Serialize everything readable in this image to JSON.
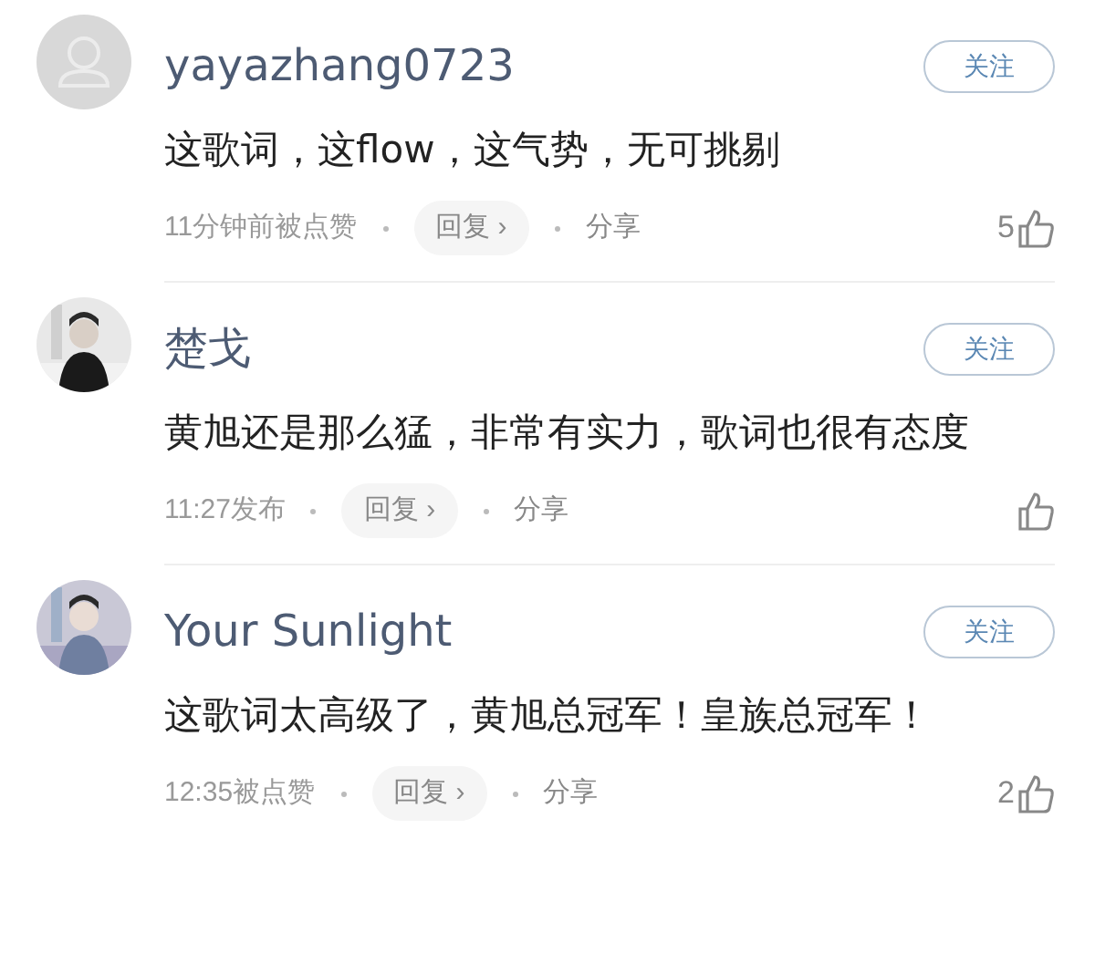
{
  "comments": [
    {
      "avatar": {
        "kind": "default"
      },
      "username": "yayazhang0723",
      "follow": "关注",
      "text": "这歌词，这flow，这气势，无可挑剔",
      "time": "11分钟前被点赞",
      "reply": "回复",
      "reply_arrow": "›",
      "share": "分享",
      "likes": "5"
    },
    {
      "username": "楚戈",
      "follow": "关注",
      "text": "黄旭还是那么猛，非常有实力，歌词也很有态度",
      "time": "11:27发布",
      "reply": "回复",
      "reply_arrow": "›",
      "share": "分享"
    },
    {
      "username": "Your Sunlight",
      "follow": "关注",
      "text": "这歌词太高级了，黄旭总冠军！皇族总冠军！",
      "time": "12:35被点赞",
      "reply": "回复",
      "reply_arrow": "›",
      "share": "分享",
      "likes": "2"
    }
  ]
}
